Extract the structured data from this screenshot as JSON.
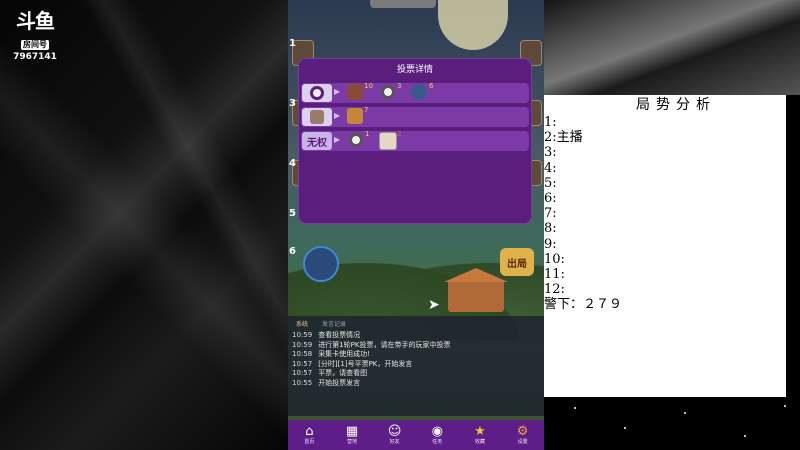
{
  "stream": {
    "logo_brand": "斗鱼",
    "logo_room_label": "房间号",
    "room_id": "7967141"
  },
  "game": {
    "seat_numbers": [
      "1",
      "2",
      "3",
      "4",
      "5",
      "6"
    ],
    "round_badge": "出局",
    "vote_dialog": {
      "title": "投票详情",
      "rows": [
        {
          "voter": "",
          "votes": [
            {
              "count": "10"
            },
            {
              "count": "3"
            },
            {
              "count": "6"
            }
          ]
        },
        {
          "voter": "",
          "votes": [
            {
              "count": "7"
            }
          ]
        },
        {
          "voter": "无权",
          "votes": [
            {
              "count": "1"
            },
            {
              "count": "2"
            }
          ]
        }
      ]
    },
    "chat": {
      "tabs": [
        "系统",
        "发言记录"
      ],
      "lines": [
        {
          "time": "10:59",
          "text": "查看投票情况"
        },
        {
          "time": "10:59",
          "text": "进行第1轮PK投票，请在带手的玩家中投票"
        },
        {
          "time": "10:58",
          "text": "采集卡使用成功!"
        },
        {
          "time": "10:57",
          "text": "[分时][1]号平票PK，开始发言"
        },
        {
          "time": "10:57",
          "text": "平票，请查看图"
        },
        {
          "time": "10:55",
          "text": "开始投票发言"
        }
      ]
    },
    "nav": [
      {
        "icon": "home-icon",
        "label": "首页"
      },
      {
        "icon": "camp-icon",
        "label": "营地"
      },
      {
        "icon": "friends-icon",
        "label": "好友"
      },
      {
        "icon": "task-icon",
        "label": "任务"
      },
      {
        "icon": "star-icon",
        "label": "收藏"
      },
      {
        "icon": "gear-icon",
        "label": "设置"
      }
    ]
  },
  "analysis": {
    "title": "局势分析",
    "lines": [
      "1:",
      "2:主播",
      "3:",
      "4:",
      "5:",
      "6:",
      "7:",
      "8:",
      "9:",
      "10:",
      "11:",
      "12:",
      "警下：２７９"
    ]
  }
}
